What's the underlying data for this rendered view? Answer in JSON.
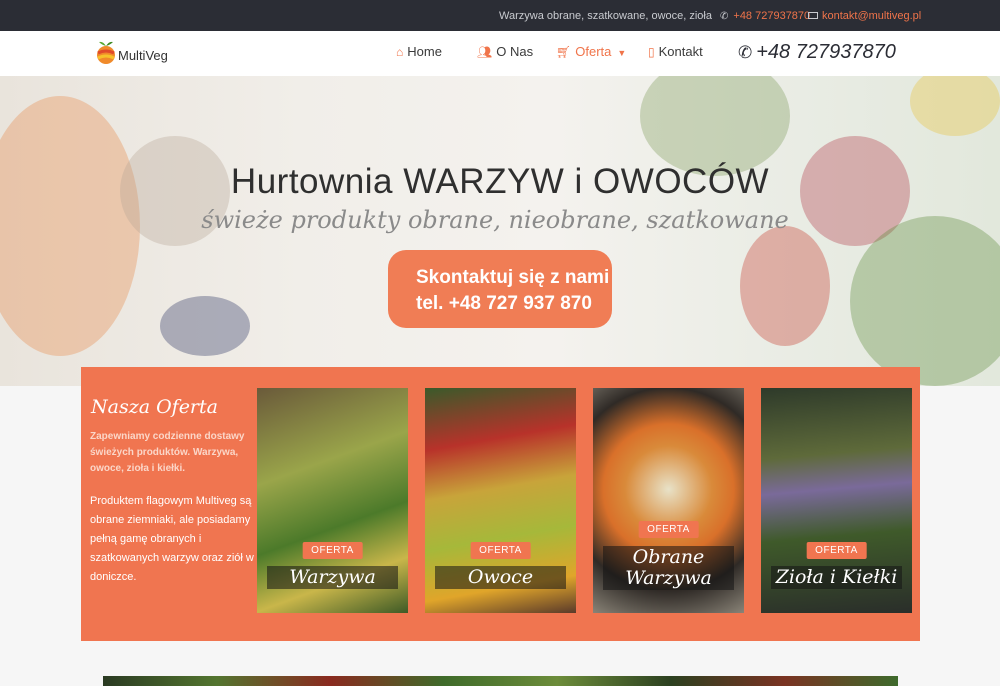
{
  "topbar": {
    "tagline": "Warzywa obrane, szatkowane, owoce, zioła",
    "phone": "+48 727937870",
    "email": "kontakt@multiveg.pl"
  },
  "header": {
    "logo_text": "MultiVeg",
    "nav": [
      {
        "label": "Home",
        "icon": "home-icon"
      },
      {
        "label": "O Nas",
        "icon": "users-icon"
      },
      {
        "label": "Oferta",
        "icon": "cart-icon",
        "active": true
      },
      {
        "label": "Kontakt",
        "icon": "mobile-icon"
      }
    ],
    "phone": "+48 727937870"
  },
  "hero": {
    "title": "Hurtownia WARZYW i OWOCÓW",
    "subtitle": "świeże produkty obrane, nieobrane, szatkowane",
    "cta_line1": "Skontaktuj się z nami",
    "cta_line2": "tel. +48 727 937 870"
  },
  "offer": {
    "title": "Nasza Oferta",
    "intro": "Zapewniamy codzienne dostawy świeżych produktów. Warzywa, owoce, zioła i kiełki.",
    "body": "Produktem flagowym Multiveg są obrane ziemniaki, ale posiadamy pełną gamę obranych i szatkowanych warzyw oraz ziół w doniczce.",
    "cards": [
      {
        "badge": "OFERTA",
        "label": "Warzywa"
      },
      {
        "badge": "OFERTA",
        "label": "Owoce"
      },
      {
        "badge": "OFERTA",
        "label": "Obrane Warzywa"
      },
      {
        "badge": "OFERTA",
        "label": "Zioła i Kiełki"
      }
    ]
  },
  "colors": {
    "accent": "#f07550",
    "topbar_bg": "#2b2d35"
  }
}
